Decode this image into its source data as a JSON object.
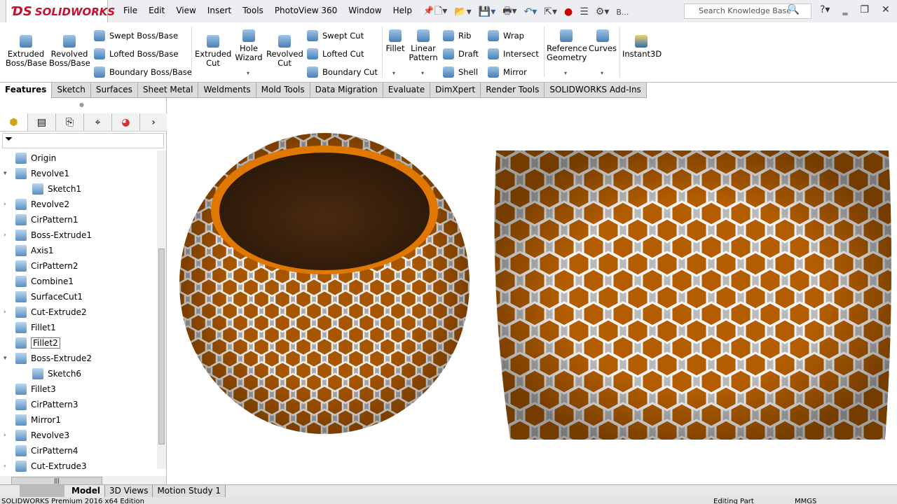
{
  "app": {
    "logo": "SOLIDWORKS",
    "menu": [
      "File",
      "Edit",
      "View",
      "Insert",
      "Tools",
      "PhotoView 360",
      "Window",
      "Help"
    ],
    "truncated": "B...",
    "search_placeholder": "Search Knowledge Base"
  },
  "ribbon": {
    "big": [
      {
        "label": "Extruded\nBoss/Base"
      },
      {
        "label": "Revolved\nBoss/Base"
      },
      {
        "label": "Extruded\nCut"
      },
      {
        "label": "Hole\nWizard"
      },
      {
        "label": "Revolved\nCut"
      },
      {
        "label": "Fillet"
      },
      {
        "label": "Linear\nPattern"
      },
      {
        "label": "Reference\nGeometry"
      },
      {
        "label": "Curves"
      },
      {
        "label": "Instant3D"
      }
    ],
    "small": [
      "Swept Boss/Base",
      "Lofted Boss/Base",
      "Boundary Boss/Base",
      "Swept Cut",
      "Lofted Cut",
      "Boundary Cut",
      "Rib",
      "Draft",
      "Shell",
      "Wrap",
      "Intersect",
      "Mirror"
    ]
  },
  "tabs": [
    "Features",
    "Sketch",
    "Surfaces",
    "Sheet Metal",
    "Weldments",
    "Mold Tools",
    "Data Migration",
    "Evaluate",
    "DimXpert",
    "Render Tools",
    "SOLIDWORKS Add-Ins"
  ],
  "tree": [
    {
      "label": "Origin",
      "exp": ""
    },
    {
      "label": "Revolve1",
      "exp": "▾"
    },
    {
      "label": "Sketch1",
      "exp": "",
      "indent": true
    },
    {
      "label": "Revolve2",
      "exp": "›"
    },
    {
      "label": "CirPattern1",
      "exp": ""
    },
    {
      "label": "Boss-Extrude1",
      "exp": "›"
    },
    {
      "label": "Axis1",
      "exp": ""
    },
    {
      "label": "CirPattern2",
      "exp": ""
    },
    {
      "label": "Combine1",
      "exp": ""
    },
    {
      "label": "SurfaceCut1",
      "exp": ""
    },
    {
      "label": "Cut-Extrude2",
      "exp": "›"
    },
    {
      "label": "Fillet1",
      "exp": ""
    },
    {
      "label": "Fillet2",
      "exp": "",
      "sel": true
    },
    {
      "label": "Boss-Extrude2",
      "exp": "▾"
    },
    {
      "label": "Sketch6",
      "exp": "",
      "indent": true
    },
    {
      "label": "Fillet3",
      "exp": ""
    },
    {
      "label": "CirPattern3",
      "exp": ""
    },
    {
      "label": "Mirror1",
      "exp": ""
    },
    {
      "label": "Revolve3",
      "exp": "›"
    },
    {
      "label": "CirPattern4",
      "exp": ""
    },
    {
      "label": "Cut-Extrude3",
      "exp": "›"
    }
  ],
  "bottom_tabs": [
    "Model",
    "3D Views",
    "Motion Study 1"
  ],
  "status": {
    "left": "SOLIDWORKS Premium 2016 x64 Edition",
    "mode": "Editing Part",
    "units": "MMGS"
  },
  "colors": {
    "accent": "#c8102e",
    "orange": "#c96a00"
  }
}
